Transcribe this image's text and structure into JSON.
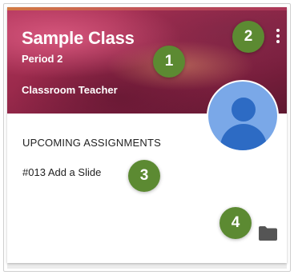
{
  "card": {
    "title": "Sample Class",
    "section": "Period 2",
    "teacher": "Classroom Teacher",
    "upcoming_label": "UPCOMING ASSIGNMENTS",
    "assignment": "#013 Add a Slide"
  },
  "icons": {
    "menu": "more-vert-icon",
    "avatar": "teacher-avatar",
    "folder": "folder-icon"
  },
  "callouts": [
    "1",
    "2",
    "3",
    "4"
  ],
  "colors": {
    "header": "#9b2a4c",
    "avatar_bg": "#7aa8e8",
    "avatar_fg": "#2d6bc4",
    "callout": "#5c8a32",
    "folder": "#555555"
  }
}
